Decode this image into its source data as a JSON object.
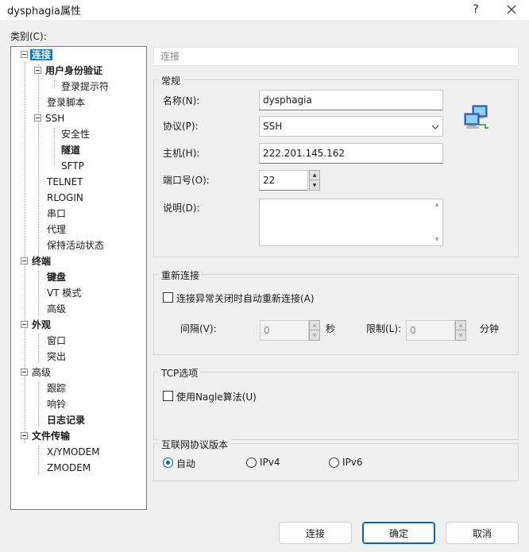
{
  "window": {
    "title": "dysphagia属性",
    "help_label": "?",
    "close_label": "X"
  },
  "category_label": "类别(C):",
  "tree": [
    {
      "label": "连接"
    },
    {
      "label": "用户身份验证"
    },
    {
      "label": "登录提示符"
    },
    {
      "label": "登录脚本"
    },
    {
      "label": "SSH"
    },
    {
      "label": "安全性"
    },
    {
      "label": "隧道"
    },
    {
      "label": "SFTP"
    },
    {
      "label": "TELNET"
    },
    {
      "label": "RLOGIN"
    },
    {
      "label": "串口"
    },
    {
      "label": "代理"
    },
    {
      "label": "保持活动状态"
    },
    {
      "label": "终端"
    },
    {
      "label": "键盘"
    },
    {
      "label": "VT 模式"
    },
    {
      "label": "高级"
    },
    {
      "label": "外观"
    },
    {
      "label": "窗口"
    },
    {
      "label": "突出"
    },
    {
      "label": "高级"
    },
    {
      "label": "跟踪"
    },
    {
      "label": "响铃"
    },
    {
      "label": "日志记录"
    },
    {
      "label": "文件传输"
    },
    {
      "label": "X/YMODEM"
    },
    {
      "label": "ZMODEM"
    }
  ],
  "section_header": "连接",
  "general": {
    "title": "常规",
    "name_label": "名称(N):",
    "name_value": "dysphagia",
    "protocol_label": "协议(P):",
    "protocol_value": "SSH",
    "host_label": "主机(H):",
    "host_value": "222.201.145.162",
    "port_label": "端口号(O):",
    "port_value": "22",
    "desc_label": "说明(D):",
    "desc_value": ""
  },
  "reconnect": {
    "title": "重新连接",
    "auto_reconnect_label": "连接异常关闭时自动重新连接(A)",
    "interval_label": "间隔(V):",
    "interval_value": "0",
    "interval_unit": "秒",
    "limit_label": "限制(L):",
    "limit_value": "0",
    "limit_unit": "分钟"
  },
  "tcp": {
    "title": "TCP选项",
    "nagle_label": "使用Nagle算法(U)"
  },
  "ipver": {
    "title": "互联网协议版本",
    "auto_label": "自动",
    "ipv4_label": "IPv4",
    "ipv6_label": "IPv6"
  },
  "buttons": {
    "connect": "连接",
    "ok": "确定",
    "cancel": "取消"
  },
  "colors": {
    "selection": "#0078d7",
    "accent": "#0067c0"
  }
}
